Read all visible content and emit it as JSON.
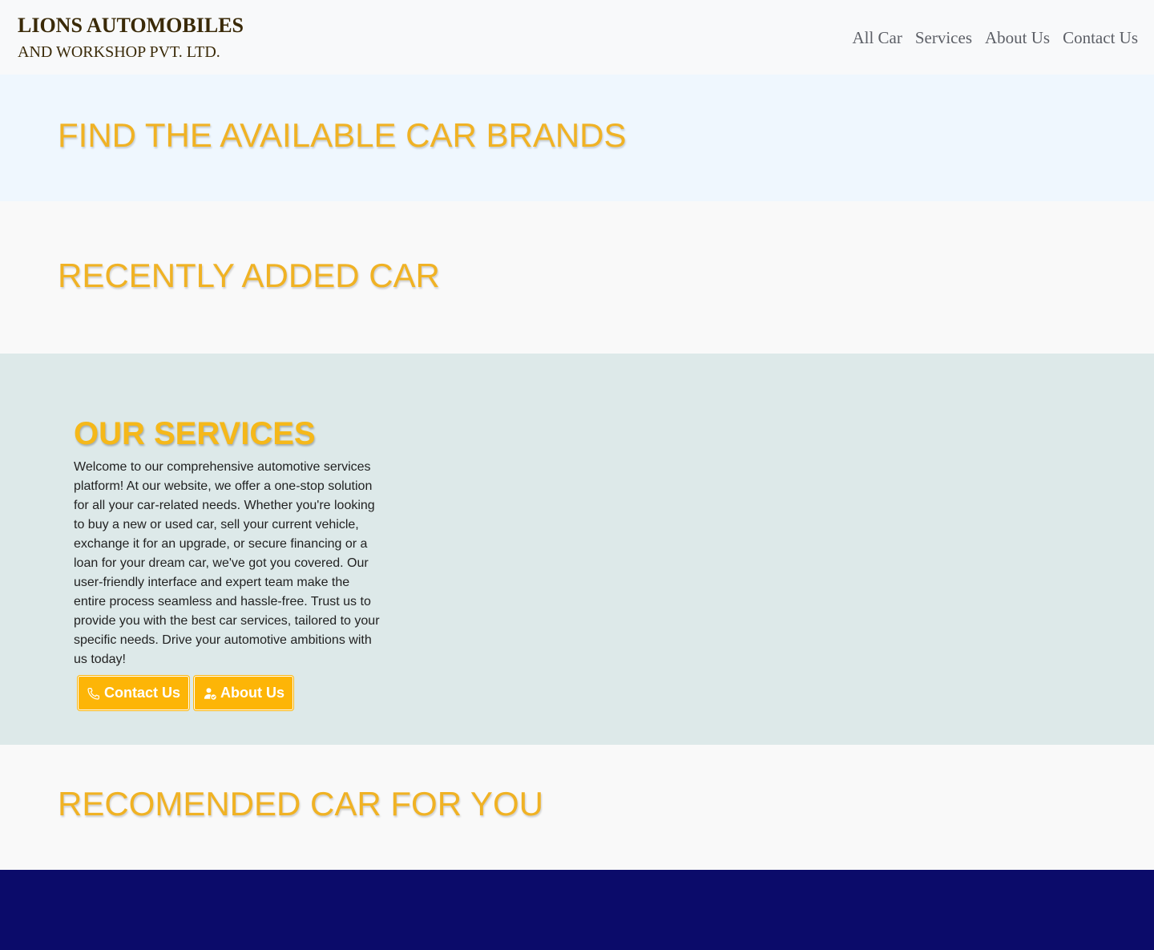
{
  "header": {
    "brand_title": "LIONS AUTOMOBILES",
    "brand_subtitle": "AND WORKSHOP PVT. LTD.",
    "nav": [
      "All Car",
      "Services",
      "About Us",
      "Contact Us"
    ]
  },
  "sections": {
    "brands_title": "FIND THE AVAILABLE CAR BRANDS",
    "recent_title": "RECENTLY ADDED CAR",
    "services_title": "OUR SERVICES",
    "services_text": "Welcome to our comprehensive automotive services platform! At our website, we offer a one-stop solution for all your car-related needs. Whether you're looking to buy a new or used car, sell your current vehicle, exchange it for an upgrade, or secure financing or a loan for your dream car, we've got you covered. Our user-friendly interface and expert team make the entire process seamless and hassle-free. Trust us to provide you with the best car services, tailored to your specific needs. Drive your automotive ambitions with us today!",
    "contact_button": "Contact Us",
    "about_button": "About Us",
    "recommended_title": "RECOMENDED CAR FOR YOU"
  },
  "icons": {
    "contact_icon": "phone-icon",
    "about_icon": "user-check-icon"
  },
  "colors": {
    "accent": "#f0b224",
    "button": "#fdb507",
    "footer": "#0b0b6a",
    "services_bg": "#dde9e9"
  }
}
